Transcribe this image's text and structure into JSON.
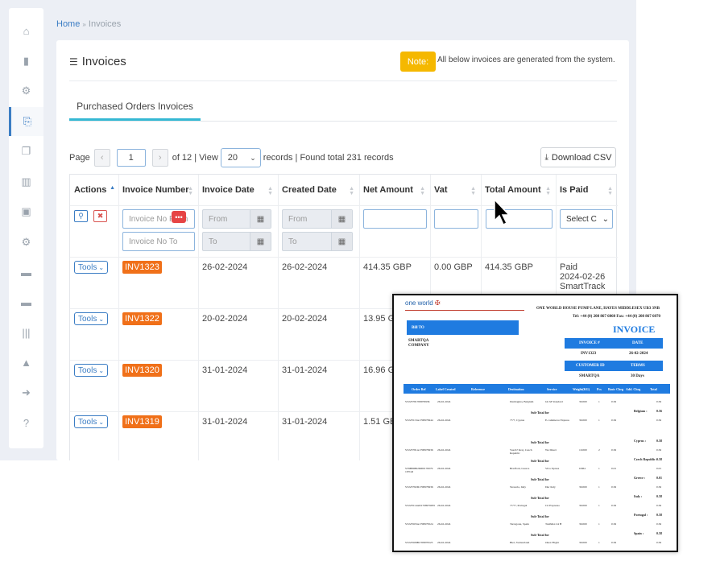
{
  "breadcrumb": {
    "home": "Home",
    "separator": "»",
    "current": "Invoices"
  },
  "sidebar": {
    "items": [
      {
        "icon": "home-icon",
        "glyph": "⌂"
      },
      {
        "icon": "book-icon",
        "glyph": "▮"
      },
      {
        "icon": "gears-icon",
        "glyph": "⚙"
      },
      {
        "icon": "pdf-icon",
        "glyph": "⎘",
        "active": true
      },
      {
        "icon": "copy-icon",
        "glyph": "❐"
      },
      {
        "icon": "bar-chart-icon",
        "glyph": "▥"
      },
      {
        "icon": "money-icon",
        "glyph": "▣"
      },
      {
        "icon": "cog-icon",
        "glyph": "⚙"
      },
      {
        "icon": "cart-icon",
        "glyph": "▬"
      },
      {
        "icon": "cart-icon",
        "glyph": "▬"
      },
      {
        "icon": "barcode-icon",
        "glyph": "|||"
      },
      {
        "icon": "road-icon",
        "glyph": "▲"
      },
      {
        "icon": "sign-out-icon",
        "glyph": "➜"
      },
      {
        "icon": "question-icon",
        "glyph": "?"
      }
    ]
  },
  "page": {
    "title": "Invoices",
    "note_label": "Note:",
    "note_text": "All below invoices are generated from the system.",
    "tab": "Purchased Orders Invoices"
  },
  "pager": {
    "page_label": "Page",
    "prev": "‹",
    "current_page": "1",
    "next": "›",
    "of_text": "of 12 | View",
    "page_size": "20",
    "records_text": "records | Found total 231 records",
    "download_csv": "Download CSV"
  },
  "table": {
    "headers": [
      "Actions",
      "Invoice Number",
      "Invoice Date",
      "Created Date",
      "Net Amount",
      "Vat",
      "Total Amount",
      "Is Paid"
    ],
    "filters": {
      "invoice_no_from": "Invoice No From",
      "invoice_no_to": "Invoice No To",
      "from": "From",
      "to": "To",
      "select": "Select C"
    },
    "tools_label": "Tools",
    "rows": [
      {
        "invoice": "INV1323",
        "invoice_date": "26-02-2024",
        "created_date": "26-02-2024",
        "net": "414.35 GBP",
        "vat": "0.00 GBP",
        "total": "414.35 GBP",
        "paid": [
          "Paid",
          "2024-02-26",
          "SmartTrack"
        ]
      },
      {
        "invoice": "INV1322",
        "invoice_date": "20-02-2024",
        "created_date": "20-02-2024",
        "net": "13.95 GB",
        "vat": "",
        "total": "",
        "paid": []
      },
      {
        "invoice": "INV1320",
        "invoice_date": "31-01-2024",
        "created_date": "31-01-2024",
        "net": "16.96 GB",
        "vat": "",
        "total": "",
        "paid": []
      },
      {
        "invoice": "INV1319",
        "invoice_date": "31-01-2024",
        "created_date": "31-01-2024",
        "net": "1.51 GBP",
        "vat": "",
        "total": "",
        "paid": []
      }
    ]
  },
  "pdf": {
    "logo": "one world",
    "address": "ONE WORLD HOUSE  PUMP LANE, HAYES  MIDDLESEX UB3 3NB",
    "contact": "Tel: +44 (0) 208 867 6060   Fax: +44 (0) 208 867 6070",
    "title": "INVOICE",
    "bill_to": "Bill TO",
    "customer": [
      "SMARTQA",
      "COMPANY"
    ],
    "labels": {
      "invoice_no": "INVOICE #",
      "date": "DATE",
      "customer_id": "CUSTOMER ID",
      "terms": "TERMS"
    },
    "values": {
      "invoice_no": "INV1323",
      "date": "26-02-2024",
      "customer_id": "SMARTQA",
      "terms": "30 Days"
    },
    "columns": [
      "Order Ref",
      "Label Created",
      "Reference",
      "Destination",
      "Service",
      "Weight(KG)",
      "Pcs",
      "Basic Chrg",
      "Add. Chrg",
      "Total"
    ],
    "lines": [
      {
        "ref": "ST223781708979936",
        "date": "26-02-2024",
        "dest": "Darmagina, Belgium",
        "service": "Gb M Standard",
        "weight": "30.000",
        "pcs": "1",
        "basic": "0.56",
        "total": "0.56"
      },
      {
        "sub": "Sub-Total for",
        "country": "Belgium :",
        "amt": "0.56"
      },
      {
        "ref": "ST223513A1708979944",
        "date": "26-02-2024",
        "dest": "????, Cyprus",
        "service": "E-commerce Express",
        "weight": "30.000",
        "pcs": "1",
        "basic": "0.56",
        "total": "0.56"
      },
      {
        "sub": "Sub-Total for",
        "country": "Cyprus :",
        "amt": "0.58"
      },
      {
        "ref": "ST223781A1708979936",
        "date": "26-02-2024",
        "dest": "Vasch? Kraj, Czech Republic",
        "service": "We Direct",
        "weight": "10.000",
        "pcs": "2",
        "basic": "0.56",
        "total": "0.56"
      },
      {
        "sub": "Sub-Total for",
        "country": "Czech Republic :",
        "amt": "0.58"
      },
      {
        "ref": "ST9B808026000170079 167GR",
        "date": "26-02-2024",
        "dest": "Bradford, Greece",
        "service": "Viva Xpress",
        "weight": "0.884",
        "pcs": "1",
        "basic": "0.01",
        "total": "0.01"
      },
      {
        "sub": "Sub-Total for",
        "country": "Greece :",
        "amt": "0.01"
      },
      {
        "ref": "ST223782D1708979936",
        "date": "26-02-2024",
        "dest": "Sicaucia, Italy",
        "service": "Dur Italy",
        "weight": "30.000",
        "pcs": "1",
        "basic": "0.56",
        "total": "0.56"
      },
      {
        "sub": "Sub-Total for",
        "country": "Italy :",
        "amt": "0.58"
      },
      {
        "ref": "ST223514AD1708979935",
        "date": "26-02-2024",
        "dest": "?????, Portugal",
        "service": "Ctt Expresso",
        "weight": "30.000",
        "pcs": "1",
        "basic": "0.56",
        "total": "0.56"
      },
      {
        "sub": "Sub-Total for",
        "country": "Portugal :",
        "amt": "0.58"
      },
      {
        "ref": "ST223503A1708979524",
        "date": "26-02-2024",
        "dest": "Tarragona, Spain",
        "service": "TaxiMex 24 H",
        "weight": "30.000",
        "pcs": "1",
        "basic": "0.56",
        "total": "0.56"
      },
      {
        "sub": "Sub-Total for",
        "country": "Spain :",
        "amt": "0.58"
      },
      {
        "ref": "ST223508B1708979523",
        "date": "26-02-2024",
        "dest": "Biel, Switzerland",
        "service": "Onex Flight",
        "weight": "30.000",
        "pcs": "1",
        "basic": "0.56",
        "total": "0.56"
      }
    ]
  }
}
